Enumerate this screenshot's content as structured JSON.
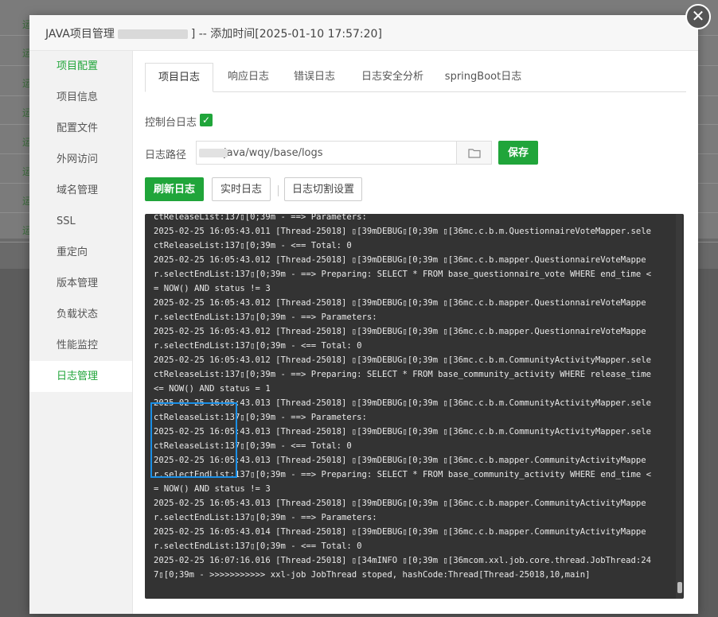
{
  "background": {
    "row_prefix": "运"
  },
  "dialog": {
    "title_prefix": "JAVA项目管理",
    "title_suffix": "] -- 添加时间[2025-01-10 17:57:20]",
    "close_glyph": "✕"
  },
  "side_menu": {
    "items": [
      {
        "label": "项目配置"
      },
      {
        "label": "项目信息"
      },
      {
        "label": "配置文件"
      },
      {
        "label": "外网访问"
      },
      {
        "label": "域名管理"
      },
      {
        "label": "SSL"
      },
      {
        "label": "重定向"
      },
      {
        "label": "版本管理"
      },
      {
        "label": "负载状态"
      },
      {
        "label": "性能监控"
      },
      {
        "label": "日志管理"
      }
    ]
  },
  "tabs": [
    {
      "label": "项目日志"
    },
    {
      "label": "响应日志"
    },
    {
      "label": "错误日志"
    },
    {
      "label": "日志安全分析"
    },
    {
      "label": "springBoot日志"
    }
  ],
  "console_log": {
    "label": "控制台日志",
    "checked": true,
    "check_glyph": "✓"
  },
  "log_path": {
    "label": "日志路径",
    "value": "java/wqy/base/logs",
    "folder_icon": "folder-icon"
  },
  "buttons": {
    "save": "保存",
    "refresh": "刷新日志",
    "realtime": "实时日志",
    "cut_settings": "日志切割设置"
  },
  "colors": {
    "accent": "#20a53a",
    "console_bg": "#333333",
    "highlight": "#1a8fe6"
  },
  "log_lines": [
    "ctReleaseList:137[0;39m - ==> Parameters:",
    "2025-02-25 16:05:43.011 [Thread-25018] [39mDEBUG[0;39m [36mc.c.b.m.QuestionnaireVoteMapper.sele",
    "ctReleaseList:137[0;39m - <== Total: 0",
    "2025-02-25 16:05:43.012 [Thread-25018] [39mDEBUG[0;39m [36mc.c.b.mapper.QuestionnaireVoteMappe",
    "r.selectEndList:137[0;39m - ==> Preparing: SELECT * FROM base_questionnaire_vote WHERE end_time <",
    "= NOW() AND status != 3",
    "2025-02-25 16:05:43.012 [Thread-25018] [39mDEBUG[0;39m [36mc.c.b.mapper.QuestionnaireVoteMappe",
    "r.selectEndList:137[0;39m - ==> Parameters:",
    "2025-02-25 16:05:43.012 [Thread-25018] [39mDEBUG[0;39m [36mc.c.b.mapper.QuestionnaireVoteMappe",
    "r.selectEndList:137[0;39m - <== Total: 0",
    "2025-02-25 16:05:43.012 [Thread-25018] [39mDEBUG[0;39m [36mc.c.b.m.CommunityActivityMapper.sele",
    "ctReleaseList:137[0;39m - ==> Preparing: SELECT * FROM base_community_activity WHERE release_time",
    "<= NOW() AND status = 1",
    "2025-02-25 16:05:43.013 [Thread-25018] [39mDEBUG[0;39m [36mc.c.b.m.CommunityActivityMapper.sele",
    "ctReleaseList:137[0;39m - ==> Parameters:",
    "2025-02-25 16:05:43.013 [Thread-25018] [39mDEBUG[0;39m [36mc.c.b.m.CommunityActivityMapper.sele",
    "ctReleaseList:137[0;39m - <== Total: 0",
    "2025-02-25 16:05:43.013 [Thread-25018] [39mDEBUG[0;39m [36mc.c.b.mapper.CommunityActivityMappe",
    "r.selectEndList:137[0;39m - ==> Preparing: SELECT * FROM base_community_activity WHERE end_time <",
    "= NOW() AND status != 3",
    "2025-02-25 16:05:43.013 [Thread-25018] [39mDEBUG[0;39m [36mc.c.b.mapper.CommunityActivityMappe",
    "r.selectEndList:137[0;39m - ==> Parameters:",
    "2025-02-25 16:05:43.014 [Thread-25018] [39mDEBUG[0;39m [36mc.c.b.mapper.CommunityActivityMappe",
    "r.selectEndList:137[0;39m - <== Total: 0",
    "2025-02-25 16:07:16.016 [Thread-25018] [34mINFO [0;39m [36mcom.xxl.job.core.thread.JobThread:24",
    "7[0;39m - >>>>>>>>>>> xxl-job JobThread stoped, hashCode:Thread[Thread-25018,10,main]"
  ]
}
